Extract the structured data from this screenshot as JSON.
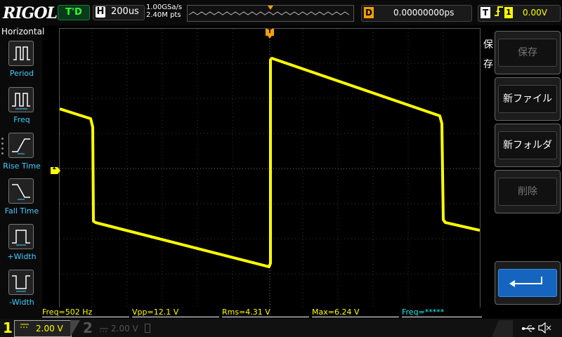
{
  "topbar": {
    "brand": "RIGOL",
    "run_state": "T'D",
    "horizontal": {
      "letter": "H",
      "timebase": "200us"
    },
    "sample": {
      "rate": "1.00GSa/s",
      "points": "2.40M pts"
    },
    "delay": {
      "letter": "D",
      "value": "0.00000000ps"
    },
    "trigger": {
      "letter": "T",
      "edge_icon": "rising-edge-icon",
      "source": "1",
      "level": "0.00V",
      "color": "#ffff00"
    }
  },
  "left_menu": {
    "title": "Horizontal",
    "items": [
      {
        "label": "Period",
        "icon": "period-icon"
      },
      {
        "label": "Freq",
        "icon": "freq-icon"
      },
      {
        "label": "Rise Time",
        "icon": "rise-time-icon"
      },
      {
        "label": "Fall Time",
        "icon": "fall-time-icon"
      },
      {
        "label": "+Width",
        "icon": "pos-width-icon"
      },
      {
        "label": "-Width",
        "icon": "neg-width-icon"
      }
    ],
    "label_color": "#44ccff"
  },
  "grid_markers": {
    "trigger_position": "T",
    "ch1_ground": "1",
    "trigger_level_arrow": "T"
  },
  "right_menu": {
    "vertical_title": "保存",
    "items": [
      {
        "label": "保存",
        "enabled": false
      },
      {
        "label": "新ファイル",
        "enabled": true
      },
      {
        "label": "新フォルダ",
        "enabled": true
      },
      {
        "label": "削除",
        "enabled": false
      },
      {
        "label": "",
        "icon": "return-icon",
        "enabled": true
      }
    ]
  },
  "measurements": [
    {
      "label": "Freq=502 Hz"
    },
    {
      "label": "Vpp=12.1 V"
    },
    {
      "label": "Rms=4.31 V"
    },
    {
      "label": "Max=6.24 V"
    },
    {
      "label": "Freq=*****"
    }
  ],
  "channels": {
    "ch1": {
      "number": "1",
      "coupling_icon": "dc-coupling-icon",
      "scale": "2.00 V",
      "color": "#ffff00"
    },
    "ch2": {
      "number": "2",
      "coupling_icon": "dc-coupling-icon",
      "scale": "2.00 V",
      "color": "#555555"
    }
  },
  "status": {
    "icons": [
      "usb-icon",
      "speaker-mute-icon"
    ]
  },
  "colors": {
    "trace": "#ffff00",
    "grid": "#3a3a3a",
    "accent_orange": "#f5a000",
    "menu_blue": "#1565c0"
  }
}
